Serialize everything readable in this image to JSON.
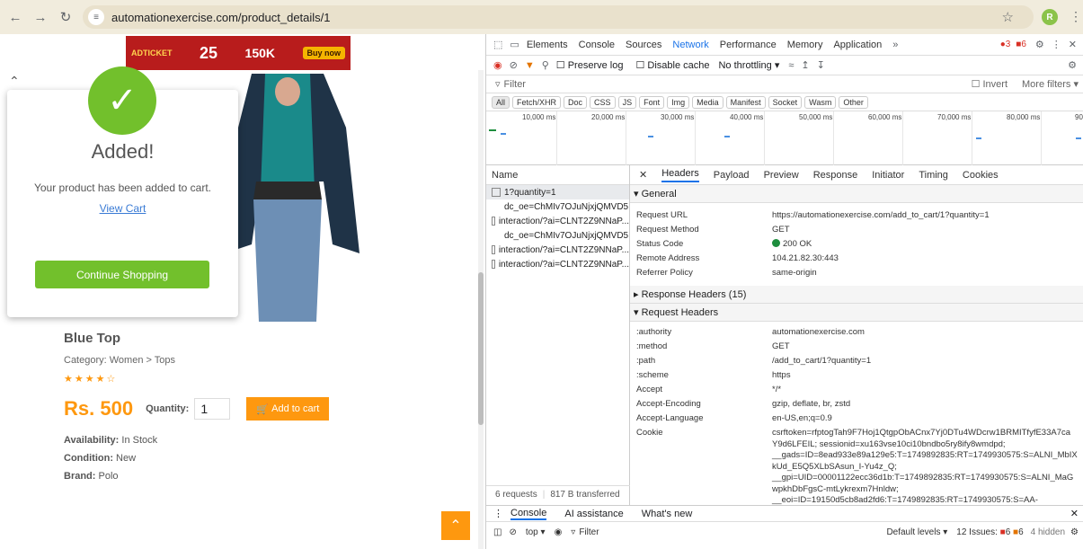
{
  "browser": {
    "url": "automationexercise.com/product_details/1",
    "profile_initial": "R"
  },
  "page": {
    "banner": {
      "brand": "ADTICKET",
      "big_number": "25",
      "promo": "150K",
      "cta": "Buy now"
    },
    "modal": {
      "title": "Added!",
      "text": "Your product has been added to cart.",
      "view_cart": "View Cart",
      "continue": "Continue Shopping"
    },
    "product": {
      "name": "Blue Top",
      "category": "Category: Women > Tops",
      "rating": 4.5,
      "price": "Rs. 500",
      "quantity_label": "Quantity:",
      "quantity": "1",
      "add_to_cart": "Add to cart",
      "availability_label": "Availability:",
      "availability": "In Stock",
      "condition_label": "Condition:",
      "condition": "New",
      "brand_label": "Brand:",
      "brand": "Polo"
    }
  },
  "devtools": {
    "tabs": [
      "Elements",
      "Console",
      "Sources",
      "Network",
      "Performance",
      "Memory",
      "Application"
    ],
    "active_tab": "Network",
    "errors": "3",
    "warnings": "6",
    "preserve_log": "Preserve log",
    "disable_cache": "Disable cache",
    "throttling": "No throttling",
    "filter_placeholder": "Filter",
    "invert": "Invert",
    "more_filters": "More filters",
    "types": [
      "All",
      "Fetch/XHR",
      "Doc",
      "CSS",
      "JS",
      "Font",
      "Img",
      "Media",
      "Manifest",
      "Socket",
      "Wasm",
      "Other"
    ],
    "timeline_ticks": [
      "10,000 ms",
      "20,000 ms",
      "30,000 ms",
      "40,000 ms",
      "50,000 ms",
      "60,000 ms",
      "70,000 ms",
      "80,000 ms",
      "90"
    ],
    "name_header": "Name",
    "requests": [
      "1?quantity=1",
      "dc_oe=ChMIv7OJuNjxjQMVD5...",
      "interaction/?ai=CLNT2Z9NNaP...",
      "dc_oe=ChMIv7OJuNjxjQMVD5...",
      "interaction/?ai=CLNT2Z9NNaP...",
      "interaction/?ai=CLNT2Z9NNaP..."
    ],
    "footer_requests": "6 requests",
    "footer_transferred": "817 B transferred",
    "detail_tabs": [
      "Headers",
      "Payload",
      "Preview",
      "Response",
      "Initiator",
      "Timing",
      "Cookies"
    ],
    "general_title": "General",
    "general": [
      {
        "k": "Request URL",
        "v": "https://automationexercise.com/add_to_cart/1?quantity=1"
      },
      {
        "k": "Request Method",
        "v": "GET"
      },
      {
        "k": "Status Code",
        "v": "200 OK"
      },
      {
        "k": "Remote Address",
        "v": "104.21.82.30:443"
      },
      {
        "k": "Referrer Policy",
        "v": "same-origin"
      }
    ],
    "response_headers_title": "Response Headers (15)",
    "request_headers_title": "Request Headers",
    "request_headers": [
      {
        "k": ":authority",
        "v": "automationexercise.com"
      },
      {
        "k": ":method",
        "v": "GET"
      },
      {
        "k": ":path",
        "v": "/add_to_cart/1?quantity=1"
      },
      {
        "k": ":scheme",
        "v": "https"
      },
      {
        "k": "Accept",
        "v": "*/*"
      },
      {
        "k": "Accept-Encoding",
        "v": "gzip, deflate, br, zstd"
      },
      {
        "k": "Accept-Language",
        "v": "en-US,en;q=0.9"
      }
    ],
    "cookie_label": "Cookie",
    "cookie_lines": [
      "csrftoken=rfptogTah9F7Hoj1QtgpObACnx7Yj0DTu4WDcrw1BRMITfyfE33A7ca",
      "Y9d6LFEIL; sessionid=xu163vse10ci10bndbo5ry8ify8wmdpd;",
      "__gads=ID=8ead933e89a129e5:T=1749892835:RT=1749930575:S=ALNI_MbIX",
      "kUd_E5Q5XLbSAsun_I-Yu4z_Q;",
      "__gpi=UID=00001122ecc36d1b:T=1749892835:RT=1749930575:S=ALNI_MaG",
      "wpkhDbFgsC-mtLykrexm7Hnldw;",
      "__eoi=ID=19150d5cb8ad2fd6:T=1749892835:RT=1749930575:S=AA-"
    ],
    "drawer_tabs": [
      "Console",
      "AI assistance",
      "What's new"
    ],
    "console_context": "top",
    "console_filter": "Filter",
    "default_levels": "Default levels",
    "issues": "12 Issues:",
    "issues_errors": "6",
    "issues_warnings": "6",
    "hidden": "4 hidden"
  }
}
